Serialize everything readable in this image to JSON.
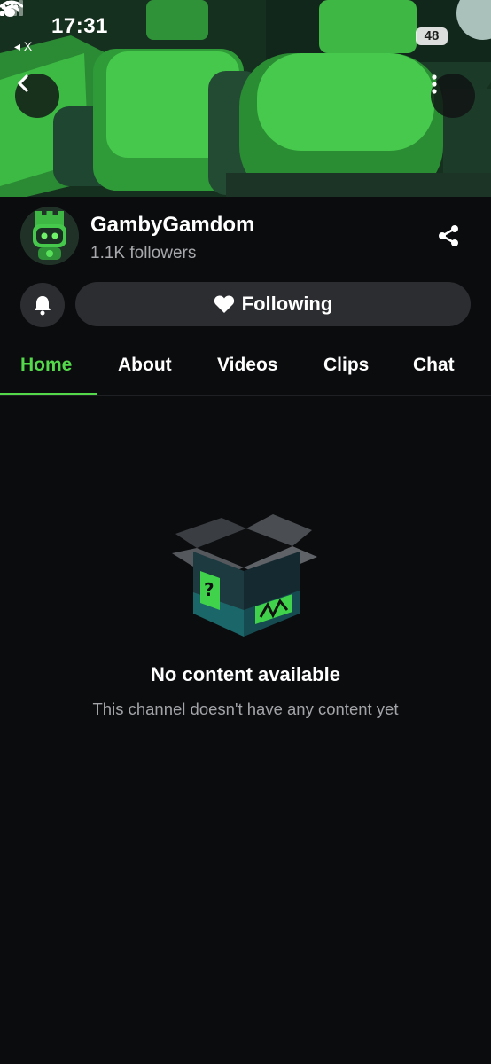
{
  "status_bar": {
    "time": "17:31",
    "back_app": "◂ X",
    "battery": "48"
  },
  "channel": {
    "name": "GambyGamdom",
    "followers": "1.1K followers"
  },
  "actions": {
    "follow_label": "Following"
  },
  "tabs": [
    {
      "label": "Home",
      "active": true
    },
    {
      "label": "About",
      "active": false
    },
    {
      "label": "Videos",
      "active": false
    },
    {
      "label": "Clips",
      "active": false
    },
    {
      "label": "Chat",
      "active": false
    }
  ],
  "empty_state": {
    "title": "No content available",
    "subtitle": "This channel doesn't have any content yet"
  },
  "colors": {
    "accent": "#53d94a",
    "background": "#0b0c0e",
    "button": "#2b2d31"
  },
  "icons": [
    "paw-icon",
    "signal-icon",
    "wifi-icon",
    "chevron-left-icon",
    "more-vertical-icon",
    "share-icon",
    "bell-icon",
    "heart-icon",
    "empty-box-icon"
  ]
}
